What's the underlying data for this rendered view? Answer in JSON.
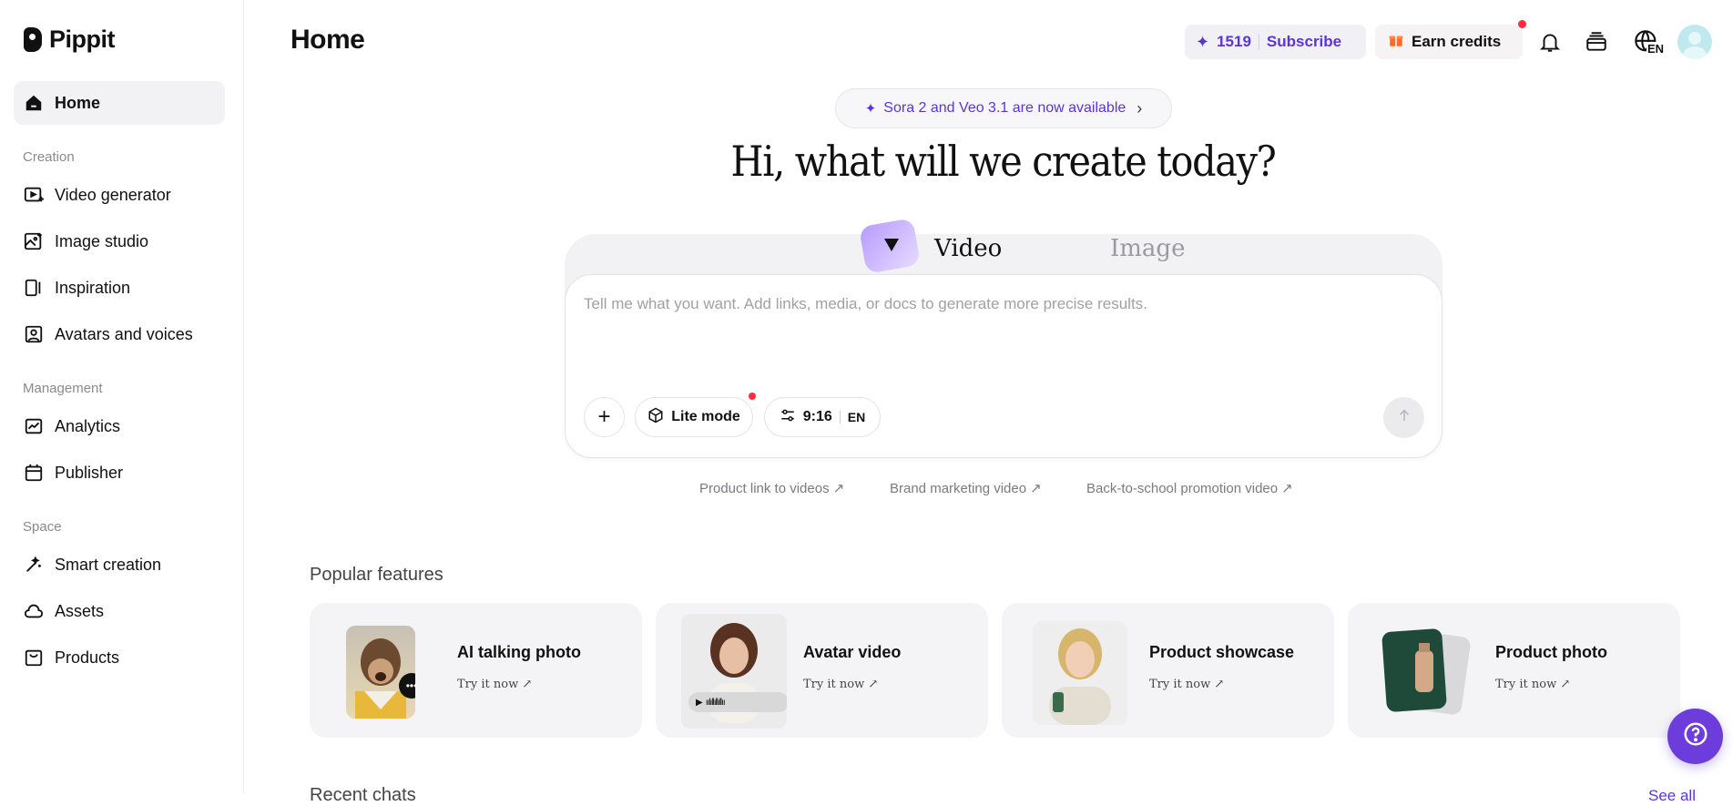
{
  "app": {
    "name": "Pippit"
  },
  "sidebar": {
    "home": "Home",
    "sections": {
      "creation": "Creation",
      "management": "Management",
      "space": "Space"
    },
    "items": {
      "video_generator": "Video generator",
      "image_studio": "Image studio",
      "inspiration": "Inspiration",
      "avatars_voices": "Avatars and voices",
      "analytics": "Analytics",
      "publisher": "Publisher",
      "smart_creation": "Smart creation",
      "assets": "Assets",
      "products": "Products"
    }
  },
  "header": {
    "title": "Home",
    "credits": "1519",
    "subscribe": "Subscribe",
    "earn_credits": "Earn credits",
    "language": "EN"
  },
  "hero": {
    "announcement": "Sora 2 and Veo 3.1 are now available",
    "title": "Hi, what will we create today?",
    "tabs": {
      "video": "Video",
      "image": "Image"
    },
    "placeholder": "Tell me what you want. Add links, media, or docs to generate more precise results.",
    "chips": {
      "mode": "Lite mode",
      "ratio": "9:16",
      "lang": "EN"
    }
  },
  "suggestions": [
    "Product link to videos",
    "Brand marketing video",
    "Back-to-school promotion video"
  ],
  "popular": {
    "heading": "Popular features",
    "cards": [
      {
        "title": "AI talking photo",
        "cta": "Try it now"
      },
      {
        "title": "Avatar video",
        "cta": "Try it now"
      },
      {
        "title": "Product showcase",
        "cta": "Try it now"
      },
      {
        "title": "Product photo",
        "cta": "Try it now"
      }
    ]
  },
  "recent": {
    "heading": "Recent chats",
    "see_all": "See all"
  },
  "colors": {
    "accent": "#5b35d5",
    "help": "#6c3ddb",
    "notify": "#ff2d3d"
  }
}
